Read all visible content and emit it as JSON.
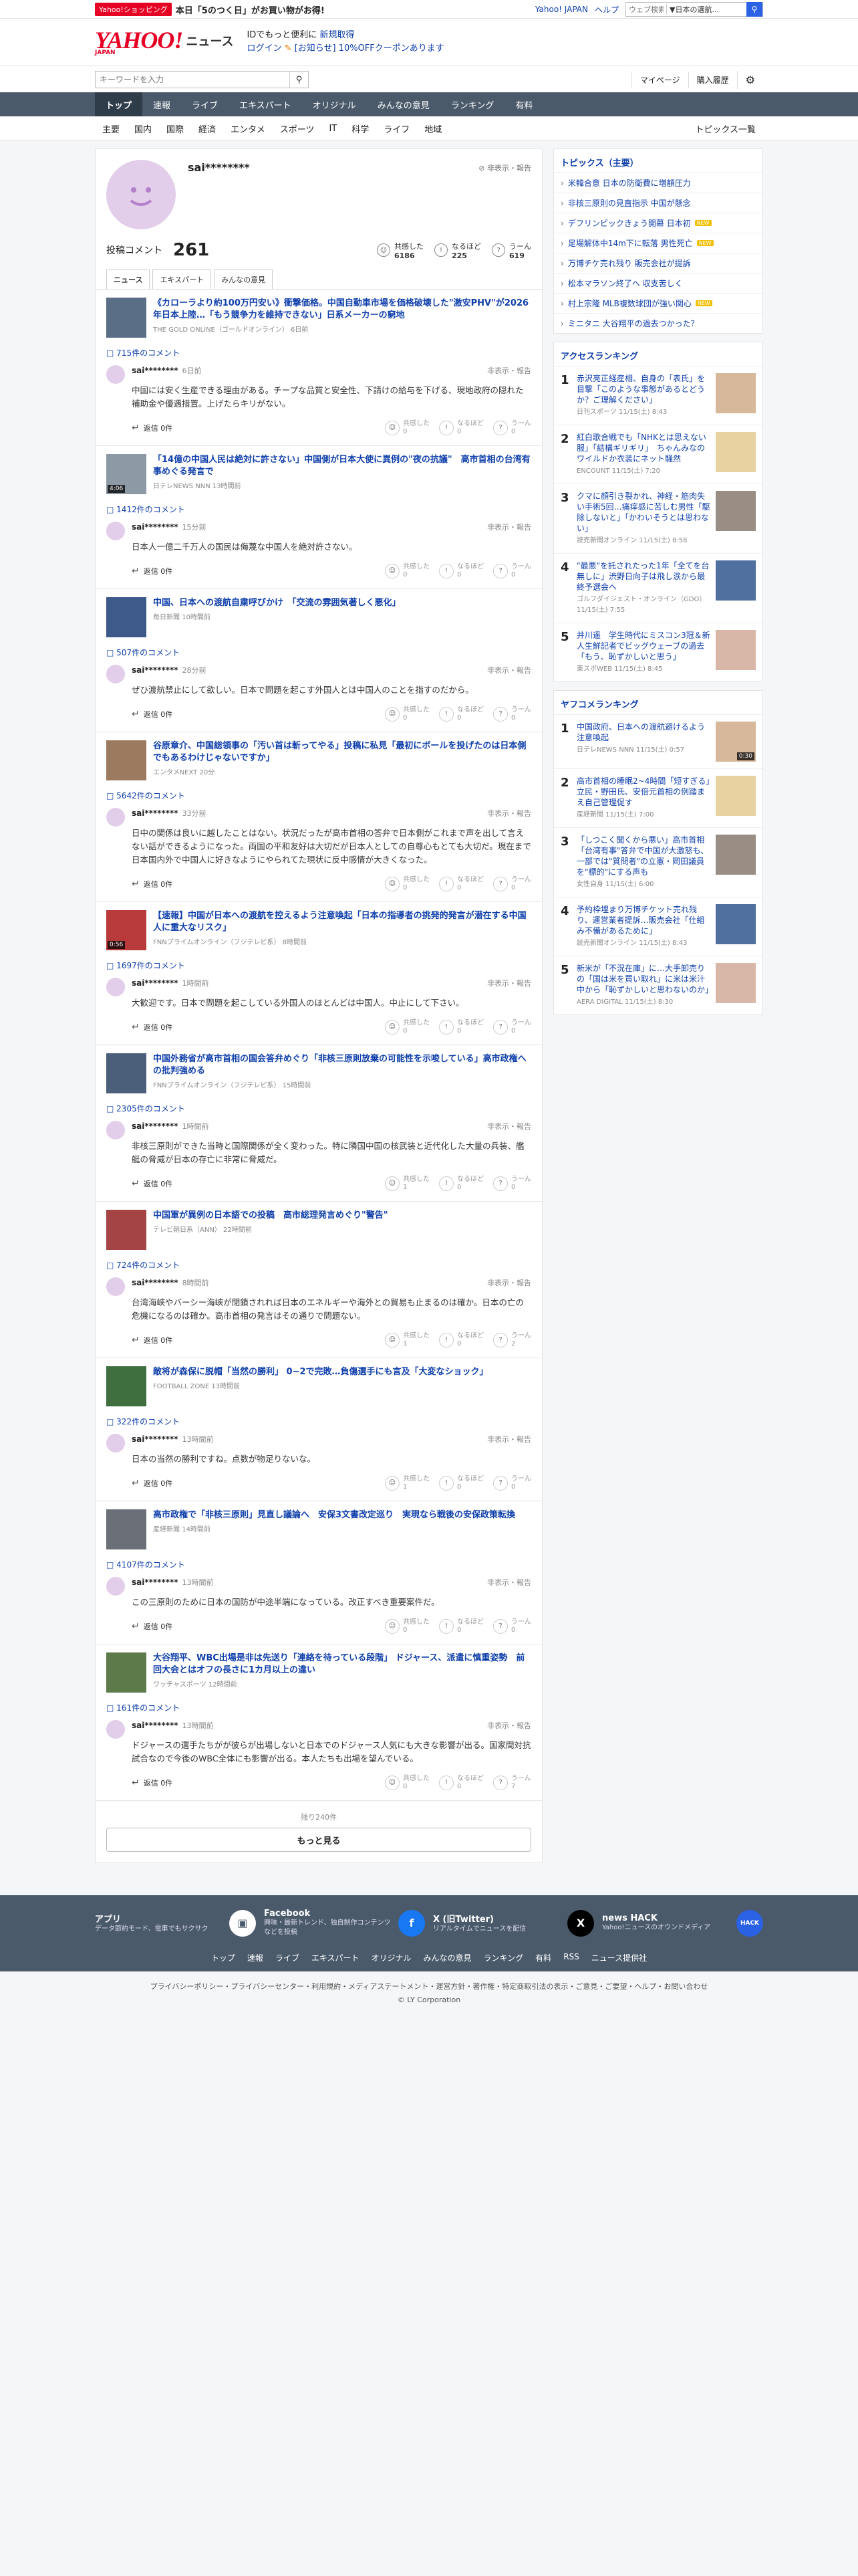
{
  "promo": {
    "badge": "Yahoo!ショッピング",
    "text": "本日「5のつく日」がお買い物がお得!",
    "links": [
      "Yahoo! JAPAN",
      "ヘルプ"
    ],
    "search_placeholder": "ウェブ検索",
    "search_scope": "▼日本の選航..."
  },
  "header": {
    "logo": "YAHOO!",
    "logo_sub": "JAPAN",
    "section": "ニュース",
    "line1a": "IDでもっと便利に",
    "line1b": "新規取得",
    "login": "ログイン",
    "line2": "[お知らせ] 10%OFFクーポンあります"
  },
  "search": {
    "placeholder": "キーワードを入力",
    "mypage": "マイページ",
    "history": "購入履歴"
  },
  "nav": [
    "トップ",
    "速報",
    "ライブ",
    "エキスパート",
    "オリジナル",
    "みんなの意見",
    "ランキング",
    "有料"
  ],
  "topics": [
    "主要",
    "国内",
    "国際",
    "経済",
    "エンタメ",
    "スポーツ",
    "IT",
    "科学",
    "ライフ",
    "地域"
  ],
  "topics_all": "トピックス一覧",
  "profile": {
    "name": "sai********",
    "report": "非表示・報告",
    "label": "投稿コメント",
    "count": "261",
    "r1": "共感した",
    "r1v": "6186",
    "r2": "なるほど",
    "r2v": "225",
    "r3": "うーん",
    "r3v": "619"
  },
  "tabs": [
    "ニュース",
    "エキスパート",
    "みんなの意見"
  ],
  "items": [
    {
      "title": "《カローラより約100万円安い》衝撃価格。中国自動車市場を価格破壊した\"激安PHV\"が2026年日本上陸…「もう競争力を維持できない」日系メーカーの窮地",
      "src": "THE GOLD ONLINE（ゴールドオンライン） 6日前",
      "cc": "715件のコメント",
      "user": "sai********",
      "time": "6日前",
      "text": "中国には安く生産できる理由がある。チープな品質と安全性、下請けの給与を下げる、現地政府の隠れた補助金や優遇措置。上げたらキリがない。",
      "reply": "返信 0件",
      "a": "0",
      "b": "0",
      "c": "0"
    },
    {
      "title": "「14億の中国人民は絶対に許さない」中国側が日本大使に異例の\"夜の抗議\"　高市首相の台湾有事めぐる発言で",
      "src": "日テレNEWS NNN 13時間前",
      "cc": "1412件のコメント",
      "user": "sai********",
      "time": "15分前",
      "text": "日本人一億二千万人の国民は侮蔑な中国人を絶対許さない。",
      "reply": "返信 0件",
      "a": "0",
      "b": "0",
      "c": "0",
      "vid": "4:06"
    },
    {
      "title": "中国、日本への渡航自粛呼びかけ　「交流の雰囲気著しく悪化」",
      "src": "毎日新聞 10時間前",
      "cc": "507件のコメント",
      "user": "sai********",
      "time": "28分前",
      "text": "ぜひ渡航禁止にして欲しい。日本で問題を起こす外国人とは中国人のことを指すのだから。",
      "reply": "返信 0件",
      "a": "0",
      "b": "0",
      "c": "0"
    },
    {
      "title": "谷原章介、中国総領事の「汚い首は斬ってやる」投稿に私見「最初にボールを投げたのは日本側でもあるわけじゃないですか」",
      "src": "エンタメNEXT 20分",
      "cc": "5642件のコメント",
      "user": "sai********",
      "time": "33分前",
      "text": "日中の関係は良いに越したことはない。状況だったが高市首相の答弁で日本側がこれまで声を出して言えない話ができるようになった。両国の平和友好は大切だが日本人としての自尊心もとても大切だ。現在まで日本国内外で中国人に好きなようにやられてた現状に反中感情が大きくなった。",
      "reply": "返信 0件",
      "a": "0",
      "b": "0",
      "c": "0"
    },
    {
      "title": "【速報】中国が日本への渡航を控えるよう注意喚起「日本の指導者の挑発的発言が潜在する中国人に重大なリスク」",
      "src": "FNNプライムオンライン（フジテレビ系） 8時間前",
      "cc": "1697件のコメント",
      "user": "sai********",
      "time": "1時間前",
      "text": "大歓迎です。日本で問題を起こしている外国人のほとんどは中国人。中止にして下さい。",
      "reply": "返信 0件",
      "a": "0",
      "b": "0",
      "c": "0",
      "vid": "0:56"
    },
    {
      "title": "中国外務省が高市首相の国会答弁めぐり「非核三原則放棄の可能性を示唆している」高市政権への批判強める",
      "src": "FNNプライムオンライン（フジテレビ系） 15時間前",
      "cc": "2305件のコメント",
      "user": "sai********",
      "time": "1時間前",
      "text": "非核三原則ができた当時と国際関係が全く変わった。特に隣国中国の核武装と近代化した大量の兵装、艦艇の脅威が日本の存亡に非常に脅威だ。",
      "reply": "返信 0件",
      "a": "1",
      "b": "0",
      "c": "0"
    },
    {
      "title": "中国軍が異例の日本語での投稿　高市総理発言めぐり\"警告\"",
      "src": "テレビ朝日系（ANN） 22時間前",
      "cc": "724件のコメント",
      "user": "sai********",
      "time": "8時間前",
      "text": "台湾海峡やバーシー海峡が閉鎖されれば日本のエネルギーや海外との貿易も止まるのは確か。日本の亡の危機になるのは確か。高市首相の発言はその通りで問題ない。",
      "reply": "返信 0件",
      "a": "1",
      "b": "0",
      "c": "2"
    },
    {
      "title": "敵将が森保に脱帽「当然の勝利」 0−2で完敗…負傷選手にも言及「大変なショック」",
      "src": "FOOTBALL ZONE 13時間前",
      "cc": "322件のコメント",
      "user": "sai********",
      "time": "13時間前",
      "text": "日本の当然の勝利ですね。点数が物足りないな。",
      "reply": "返信 0件",
      "a": "1",
      "b": "0",
      "c": "0"
    },
    {
      "title": "高市政権で「非核三原則」見直し議論へ　安保3文書改定巡り　実現なら戦後の安保政策転換",
      "src": "産経新聞 14時間前",
      "cc": "4107件のコメント",
      "user": "sai********",
      "time": "13時間前",
      "text": "この三原則のために日本の国防が中途半端になっている。改正すべき重要案件だ。",
      "reply": "返信 0件",
      "a": "0",
      "b": "0",
      "c": "0"
    },
    {
      "title": "大谷翔平、WBC出場是非は先送り「連絡を待っている段階」 ドジャース、派遣に慎重姿勢　前回大会とはオフの長さに1カ月以上の違い",
      "src": "ワッチャスポーツ 12時間前",
      "cc": "161件のコメント",
      "user": "sai********",
      "time": "13時間前",
      "text": "ドジャースの選手たちがが彼らが出場しないと日本でのドジャース人気にも大きな影響が出る。国家間対抗試合なので今後のWBC全体にも影響が出る。本人たちも出場を望んでいる。",
      "reply": "返信 0件",
      "a": "0",
      "b": "0",
      "c": "7"
    }
  ],
  "more": {
    "rest": "残り240件",
    "btn": "もっと見る"
  },
  "side": {
    "topics_title": "トピックス（主要）",
    "topics": [
      {
        "t": "米韓合意 日本の防衛費に増額圧力",
        "new": false
      },
      {
        "t": "非核三原則の見直指示 中国が懸念",
        "new": false
      },
      {
        "t": "デフリンピックきょう開幕 日本初",
        "new": true
      },
      {
        "t": "足場解体中14m下に転落 男性死亡",
        "new": true
      },
      {
        "t": "万博チケ売れ残り 販売会社が提訴",
        "new": false
      },
      {
        "t": "松本マラソン終了へ 収支苦しく",
        "new": false
      },
      {
        "t": "村上宗隆 MLB複数球団が強い関心",
        "new": true
      },
      {
        "t": "ミニタニ 大谷翔平の過去つかった？",
        "new": false
      }
    ],
    "access_title": "アクセスランキング",
    "access": [
      {
        "t": "赤沢亮正経産相、自身の「表氏」を目撃「このような事態があるとどうか？ご理解ください」",
        "s": "日刊スポーツ 11/15(土) 8:43"
      },
      {
        "t": "紅白歌合戦でも「NHKとは思えない服」「結構ギリギリ」　ちゃんみなのワイルドか衣装にネット騒然",
        "s": "ENCOUNT 11/15(土) 7:20"
      },
      {
        "t": "クマに顔引き裂かれ、神経・筋肉失い手術5回…痛痒感に苦しむ男性「駆除しないと」「かわいそうとは思わない」",
        "s": "読売新聞オンライン 11/15(土) 8:58"
      },
      {
        "t": "\"最悪\"を託されたった1年「全てを台無しに」渋野日向子は飛し涙から最終予選会へ",
        "s": "ゴルフダイジェスト・オンライン（GDO） 11/15(土) 7:55"
      },
      {
        "t": "井川遥　学生時代にミスコン3冠＆新人生鮮記者でビッグウェーブの過去「もう、恥ずかしいと思う」",
        "s": "東スポWEB 11/15(土) 8:45"
      }
    ],
    "yc_title": "ヤフコメランキング",
    "yc": [
      {
        "t": "中国政府、日本への渡航避けるよう注意喚起",
        "s": "日テレNEWS NNN 11/15(土) 0:57",
        "vid": "0:30"
      },
      {
        "t": "高市首相の睡眠2~4時間「短すぎる」立民・野田氏、安倍元首相の例踏まえ自己管理促す",
        "s": "産経新聞 11/15(土) 7:00"
      },
      {
        "t": "「しつこく聞くから悪い」高市首相「台湾有事\"答弁で中国が大激怒も、一部では\"質問者\"の立憲・岡田議員を\"標的\"にする声も",
        "s": "女性自身 11/15(土) 6:00"
      },
      {
        "t": "予約枠埋まり万博チケット売れ残り、運営業者提訴…販売会社「仕組み不備があるために」",
        "s": "読売新聞オンライン 11/15(土) 8:43"
      },
      {
        "t": "新米が「不況在庫」に…大手卸売りの「国は米を買い取れ」に米は米汁中から「恥ずかしいと思わないのか」",
        "s": "AERA DIGITAL 11/15(土) 8:30"
      }
    ]
  },
  "footer": {
    "cards": [
      {
        "t": "アプリ",
        "d": "データ節約モード、電車でもサクサク",
        "i": "▣"
      },
      {
        "t": "Facebook",
        "d": "興味・最新トレンド、独自制作コンテンツなどを投稿",
        "i": "f"
      },
      {
        "t": "X (旧Twitter)",
        "d": "リアルタイムでニュースを配信",
        "i": "X"
      },
      {
        "t": "news HACK",
        "d": "Yahoo!ニュースのオウンドメディア",
        "i": "HACK"
      }
    ],
    "links": [
      "トップ",
      "速報",
      "ライブ",
      "エキスパート",
      "オリジナル",
      "みんなの意見",
      "ランキング",
      "有料",
      "RSS",
      "ニュース提供社"
    ],
    "legal": "プライバシーポリシー・プライバシーセンター・利用規約・メディアステートメント・運営方針・著作権・特定商取引法の表示・ご意見・ご要望・ヘルプ・お問い合わせ",
    "copy": "© LY Corporation"
  }
}
